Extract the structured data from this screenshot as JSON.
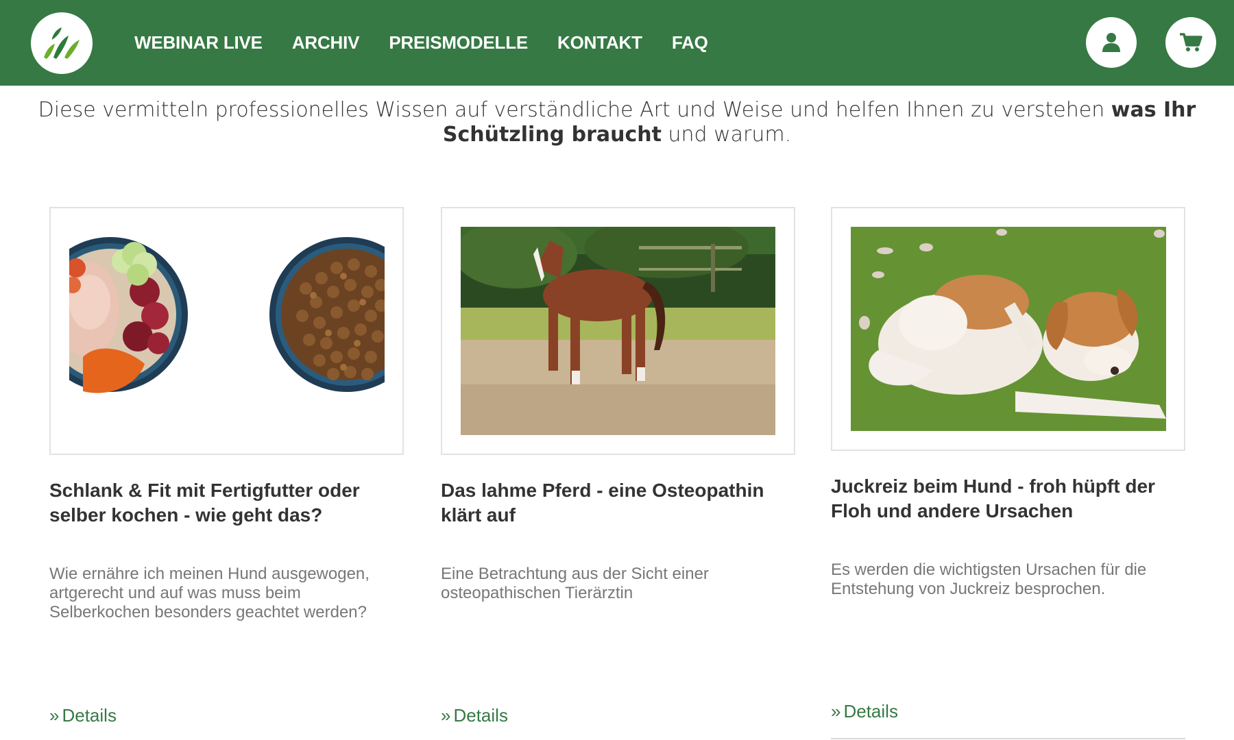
{
  "brand": {
    "primary_color": "#367944",
    "logo_icon": "leaf-logo-icon"
  },
  "nav": {
    "items": [
      {
        "label": "WEBINAR LIVE"
      },
      {
        "label": "ARCHIV"
      },
      {
        "label": "PREISMODELLE"
      },
      {
        "label": "KONTAKT"
      },
      {
        "label": "FAQ"
      }
    ],
    "user_icon": "user-icon",
    "cart_icon": "cart-icon"
  },
  "intro": {
    "text_before": "Diese vermitteln professionelles Wissen auf verständliche Art und Weise und helfen Ihnen zu verstehen ",
    "text_bold": "was Ihr Schützling braucht",
    "text_after": " und warum."
  },
  "cards": [
    {
      "image_alt": "Zwei Futternäpfe: selbst gekochtes Futter und Trockenfutter",
      "title": "Schlank & Fit mit Fertigfutter oder selber kochen - wie geht das?",
      "description": "Wie ernähre ich meinen Hund ausgewogen, artgerecht und auf was muss beim Selberkochen besonders geachtet werden?",
      "link_label": "Details"
    },
    {
      "image_alt": "Braunes Pferd trabt auf einem Sandplatz",
      "title": "Das lahme Pferd - eine Osteopathin klärt auf",
      "description": "Eine Betrachtung aus der Sicht einer osteopathischen Tierärztin",
      "link_label": "Details"
    },
    {
      "image_alt": "Hund kratzt sich im Gras",
      "title": "Juckreiz beim Hund - froh hüpft der Floh und andere Ursachen",
      "description": "Es werden die wichtigsten Ursachen für die Entstehung von Juckreiz besprochen.",
      "link_label": "Details"
    }
  ]
}
